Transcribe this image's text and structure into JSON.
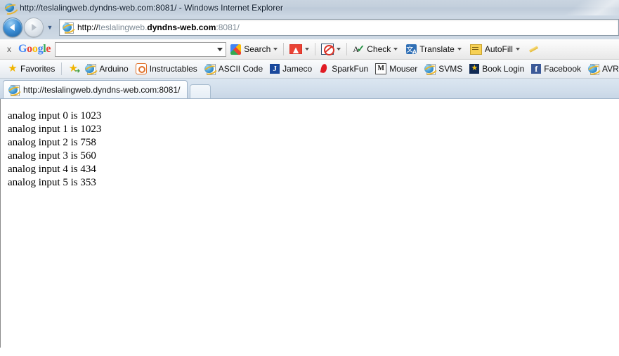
{
  "window": {
    "title": "http://teslalingweb.dyndns-web.com:8081/ - Windows Internet Explorer",
    "app_icon": "internet-explorer-icon"
  },
  "navigation": {
    "back_label": "Back",
    "forward_label": "Forward",
    "recent_pages_label": "Recent Pages",
    "address": {
      "scheme": "http://",
      "host_prefix": "teslalingweb.",
      "host_bold": "dyndns-web.com",
      "port_path": ":8081/",
      "full": "http://teslalingweb.dyndns-web.com:8081/"
    }
  },
  "google_toolbar": {
    "close_label": "x",
    "logo": [
      {
        "ch": "G",
        "color": "#4285f4"
      },
      {
        "ch": "o",
        "color": "#ea4335"
      },
      {
        "ch": "o",
        "color": "#fbbc05"
      },
      {
        "ch": "g",
        "color": "#4285f4"
      },
      {
        "ch": "l",
        "color": "#34a853"
      },
      {
        "ch": "e",
        "color": "#ea4335"
      }
    ],
    "search_value": "",
    "search_placeholder": "",
    "search_button": "Search",
    "gmail_label": "",
    "popup_blocker_label": "",
    "items": [
      {
        "label": "Check",
        "icon": "spellcheck-icon"
      },
      {
        "label": "Translate",
        "icon": "translate-icon"
      },
      {
        "label": "AutoFill",
        "icon": "autofill-icon"
      }
    ],
    "pencil_label": ""
  },
  "favorites_bar": {
    "favorites_label": "Favorites",
    "add_label": "",
    "items": [
      {
        "label": "Arduino",
        "icon": "ie-page-icon"
      },
      {
        "label": "Instructables",
        "icon": "instructables-icon"
      },
      {
        "label": "ASCII Code",
        "icon": "ie-page-icon"
      },
      {
        "label": "Jameco",
        "icon": "jameco-icon"
      },
      {
        "label": "SparkFun",
        "icon": "sparkfun-icon"
      },
      {
        "label": "Mouser",
        "icon": "mouser-icon"
      },
      {
        "label": "SVMS",
        "icon": "ie-page-icon"
      },
      {
        "label": "Book Login",
        "icon": "booklogin-star-icon"
      },
      {
        "label": "Facebook",
        "icon": "facebook-icon"
      },
      {
        "label": "AVR Fuse",
        "icon": "ie-page-icon"
      }
    ]
  },
  "tabs": {
    "active": "http://teslalingweb.dyndns-web.com:8081/",
    "new_tab_label": ""
  },
  "page": {
    "lines": [
      "analog input 0 is 1023",
      "analog input 1 is 1023",
      "analog input 2 is 758",
      "analog input 3 is 560",
      "analog input 4 is 434",
      "analog input 5 is 353"
    ]
  }
}
